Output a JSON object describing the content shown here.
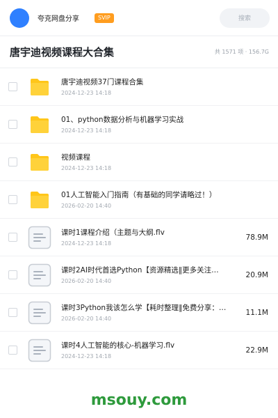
{
  "header": {
    "share_name": "夸克网盘分享",
    "badge": "SVIP",
    "search_label": "搜索"
  },
  "title": {
    "text": "唐宇迪视频课程大合集",
    "summary": "共 1571 项 · 156.7G"
  },
  "files": [
    {
      "type": "folder",
      "name": "唐宇迪视频37门课程合集",
      "date": "2024-12-23 14:18",
      "size": ""
    },
    {
      "type": "folder",
      "name": "01、python数据分析与机器学习实战",
      "date": "2024-12-23 14:18",
      "size": ""
    },
    {
      "type": "folder",
      "name": "视频课程",
      "date": "2024-12-23 14:18",
      "size": ""
    },
    {
      "type": "folder",
      "name": "01人工智能入门指南（有基础的同学请略过！）",
      "date": "2026-02-20 14:40",
      "size": ""
    },
    {
      "type": "file",
      "name": "课时1课程介绍（主题与大纲.flv",
      "date": "2024-12-23 14:18",
      "size": "78.9M"
    },
    {
      "type": "file",
      "name": "课时2AI时代首选Python【资源精选‖更多关注…",
      "date": "2026-02-20 14:40",
      "size": "20.9M"
    },
    {
      "type": "file",
      "name": "课时3Python我该怎么学【耗时整理‖免费分享：…",
      "date": "2026-02-20 14:40",
      "size": "11.1M"
    },
    {
      "type": "file",
      "name": "课时4人工智能的核心-机器学习.flv",
      "date": "2024-12-23 14:18",
      "size": "22.9M"
    }
  ],
  "watermark": "msouy.com",
  "colors": {
    "accent": "#2f80ff",
    "svip": "#ff9d1f",
    "folder": "#ffc61a",
    "watermark": "#2e9a3c"
  }
}
